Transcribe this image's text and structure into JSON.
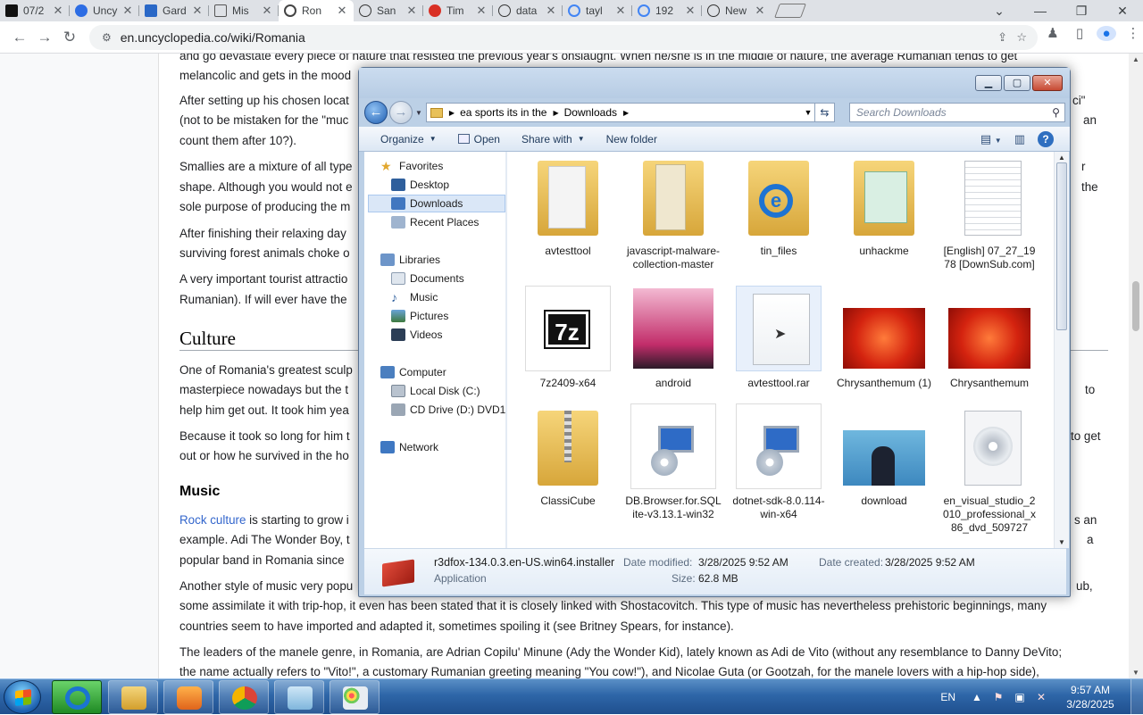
{
  "browser": {
    "tabs": [
      {
        "title": "07/2",
        "fav": "#111111"
      },
      {
        "title": "Uncy",
        "fav": "#2d6de4"
      },
      {
        "title": "Gard",
        "fav": "#2a68c7"
      },
      {
        "title": "Mis",
        "fav": "#555555"
      },
      {
        "title": "Ron",
        "fav": "#444444"
      },
      {
        "title": "San",
        "fav": "#333333"
      },
      {
        "title": "Tim",
        "fav": "#d93025"
      },
      {
        "title": "data",
        "fav": "#333333"
      },
      {
        "title": "tayl",
        "fav": "#4285f4"
      },
      {
        "title": "192",
        "fav": "#4285f4"
      },
      {
        "title": "New",
        "fav": "#333333"
      }
    ],
    "url": "en.uncyclopedia.co/wiki/Romania"
  },
  "article": {
    "p1": "and go devastate every piece of nature that resisted the previous year's onslaught. When he/she is in the middle of nature, the average Rumanian tends to get",
    "p1b": "melancolic and gets in the mood",
    "p2a": "After setting up his chosen locat",
    "p2a_r": "ci\"",
    "p2b": "(not to be mistaken for the \"muc",
    "p2b_r": "an",
    "p2c": "count them after 10?).",
    "p3a": "Smallies are a mixture of all type",
    "p3a_r": "r",
    "p3b": "shape. Although you would not e",
    "p3b_r": "the",
    "p3c": "sole purpose of producing the m",
    "p4a": "After finishing their relaxing day",
    "p4b": "surviving forest animals choke o",
    "p5a": "A very important tourist attractio",
    "p5b": "Rumanian). If will ever have the",
    "h_culture": "Culture",
    "p6a": "One of Romania's greatest sculp",
    "p6b": "masterpiece nowadays but the t",
    "p6b_r": "to",
    "p6c": "help him get out. It took him yea",
    "p7a": "Because it took so long for him t",
    "p7a_r": "to get",
    "p7b": "out or how he survived in the ho",
    "h_music": "Music",
    "p8a_link": "Rock culture",
    "p8a": " is starting to grow i",
    "p8a_r": "s an",
    "p8b": "example. Adi The Wonder Boy, t",
    "p8b_r": "a",
    "p8c": "popular band in Romania since",
    "p9a": "Another style of music very popu",
    "p9a_r": "ub,",
    "p9b": "some assimilate it with trip-hop, it even has been stated that it is closely linked with Shostacovitch. This type of music has nevertheless prehistoric beginnings, many",
    "p9c": "countries seem to have imported and adapted it, sometimes spoiling it (see Britney Spears, for instance).",
    "p10a": "The leaders of the manele genre, in Romania, are Adrian Copilu' Minune (Ady the Wonder Kid), lately known as Adi de Vito (without any resemblance to Danny DeVito;",
    "p10b": "the name actually refers to \"Vito!\", a customary Rumanian greeting meaning \"You cow!\"), and Nicolae Guta (or Gootzah, for the manele lovers with a hip-hop side),"
  },
  "explorer": {
    "address": [
      "ea sports its in the",
      "Downloads"
    ],
    "search_placeholder": "Search Downloads",
    "commands": {
      "organize": "Organize",
      "open": "Open",
      "share": "Share with",
      "new_folder": "New folder"
    },
    "nav": {
      "favorites": "Favorites",
      "desktop": "Desktop",
      "downloads": "Downloads",
      "recent": "Recent Places",
      "libraries": "Libraries",
      "documents": "Documents",
      "music": "Music",
      "pictures": "Pictures",
      "videos": "Videos",
      "computer": "Computer",
      "local_disk": "Local Disk (C:)",
      "cd_drive": "CD Drive (D:) DVD1",
      "network": "Network"
    },
    "items": [
      {
        "label": "avtesttool",
        "kind": "folder"
      },
      {
        "label": "javascript-malware-collection-master",
        "kind": "folder"
      },
      {
        "label": "tin_files",
        "kind": "folder-ie"
      },
      {
        "label": "unhackme",
        "kind": "folder"
      },
      {
        "label": "[English] 07_27_1978 [DownSub.com]",
        "kind": "text"
      },
      {
        "label": "7z2409-x64",
        "kind": "sevenzip"
      },
      {
        "label": "android",
        "kind": "image-pink"
      },
      {
        "label": "avtesttool.rar",
        "kind": "blank"
      },
      {
        "label": "Chrysanthemum (1)",
        "kind": "image-flower"
      },
      {
        "label": "Chrysanthemum",
        "kind": "image-flower"
      },
      {
        "label": "ClassiCube",
        "kind": "zip"
      },
      {
        "label": "DB.Browser.for.SQLite-v3.13.1-win32",
        "kind": "installer"
      },
      {
        "label": "dotnet-sdk-8.0.114-win-x64",
        "kind": "installer"
      },
      {
        "label": "download",
        "kind": "image-photo"
      },
      {
        "label": "en_visual_studio_2010_professional_x86_dvd_509727",
        "kind": "disc"
      }
    ],
    "status": {
      "filename": "r3dfox-134.0.3.en-US.win64.installer",
      "type": "Application",
      "modified_label": "Date modified:",
      "modified": "3/28/2025 9:52 AM",
      "created_label": "Date created:",
      "created": "3/28/2025 9:52 AM",
      "size_label": "Size:",
      "size": "62.8 MB"
    }
  },
  "taskbar": {
    "lang": "EN",
    "time": "9:57 AM",
    "date": "3/28/2025"
  }
}
